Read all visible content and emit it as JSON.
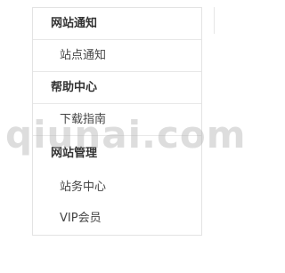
{
  "sidebar": {
    "sections": [
      {
        "title": "网站通知",
        "items": [
          "站点通知"
        ]
      },
      {
        "title": "帮助中心",
        "items": [
          "下载指南"
        ]
      },
      {
        "title": "网站管理",
        "items": [
          "站务中心",
          "VIP会员"
        ]
      }
    ]
  },
  "watermark": {
    "text": "qiunai.com"
  }
}
